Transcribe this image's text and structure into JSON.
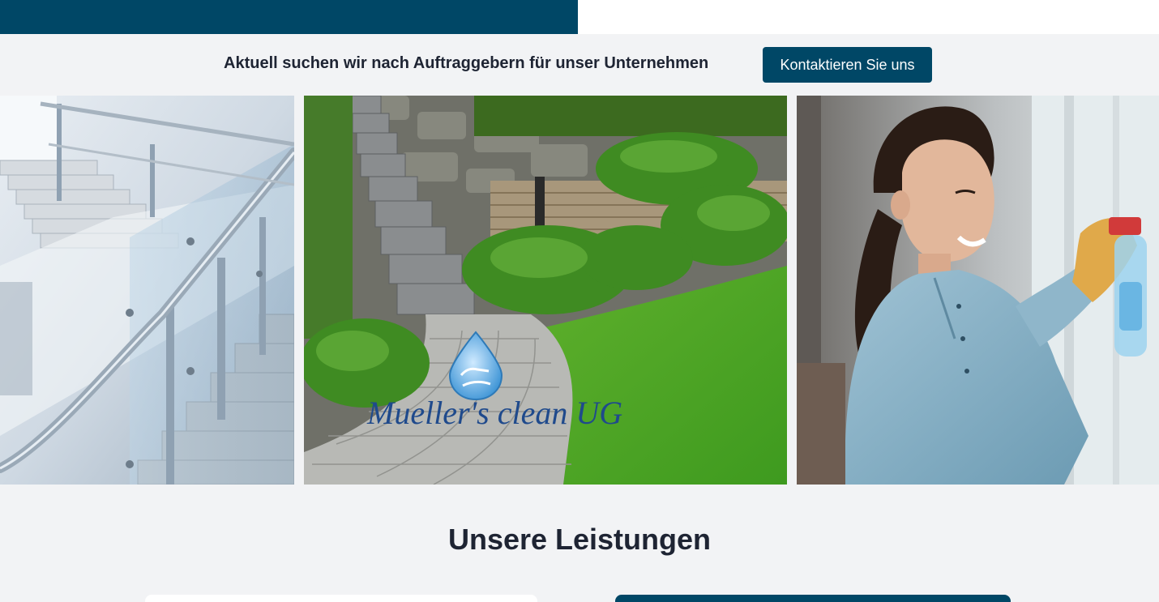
{
  "announcement": {
    "text": "Aktuell suchen wir nach Auftraggebern für unser Unternehmen",
    "button_label": "Kontaktieren Sie uns"
  },
  "gallery": {
    "logo_text": "Mueller's clean UG"
  },
  "services": {
    "title": "Unsere Leistungen"
  },
  "colors": {
    "brand": "#004766",
    "background": "#f2f3f5",
    "text": "#1e2433"
  }
}
